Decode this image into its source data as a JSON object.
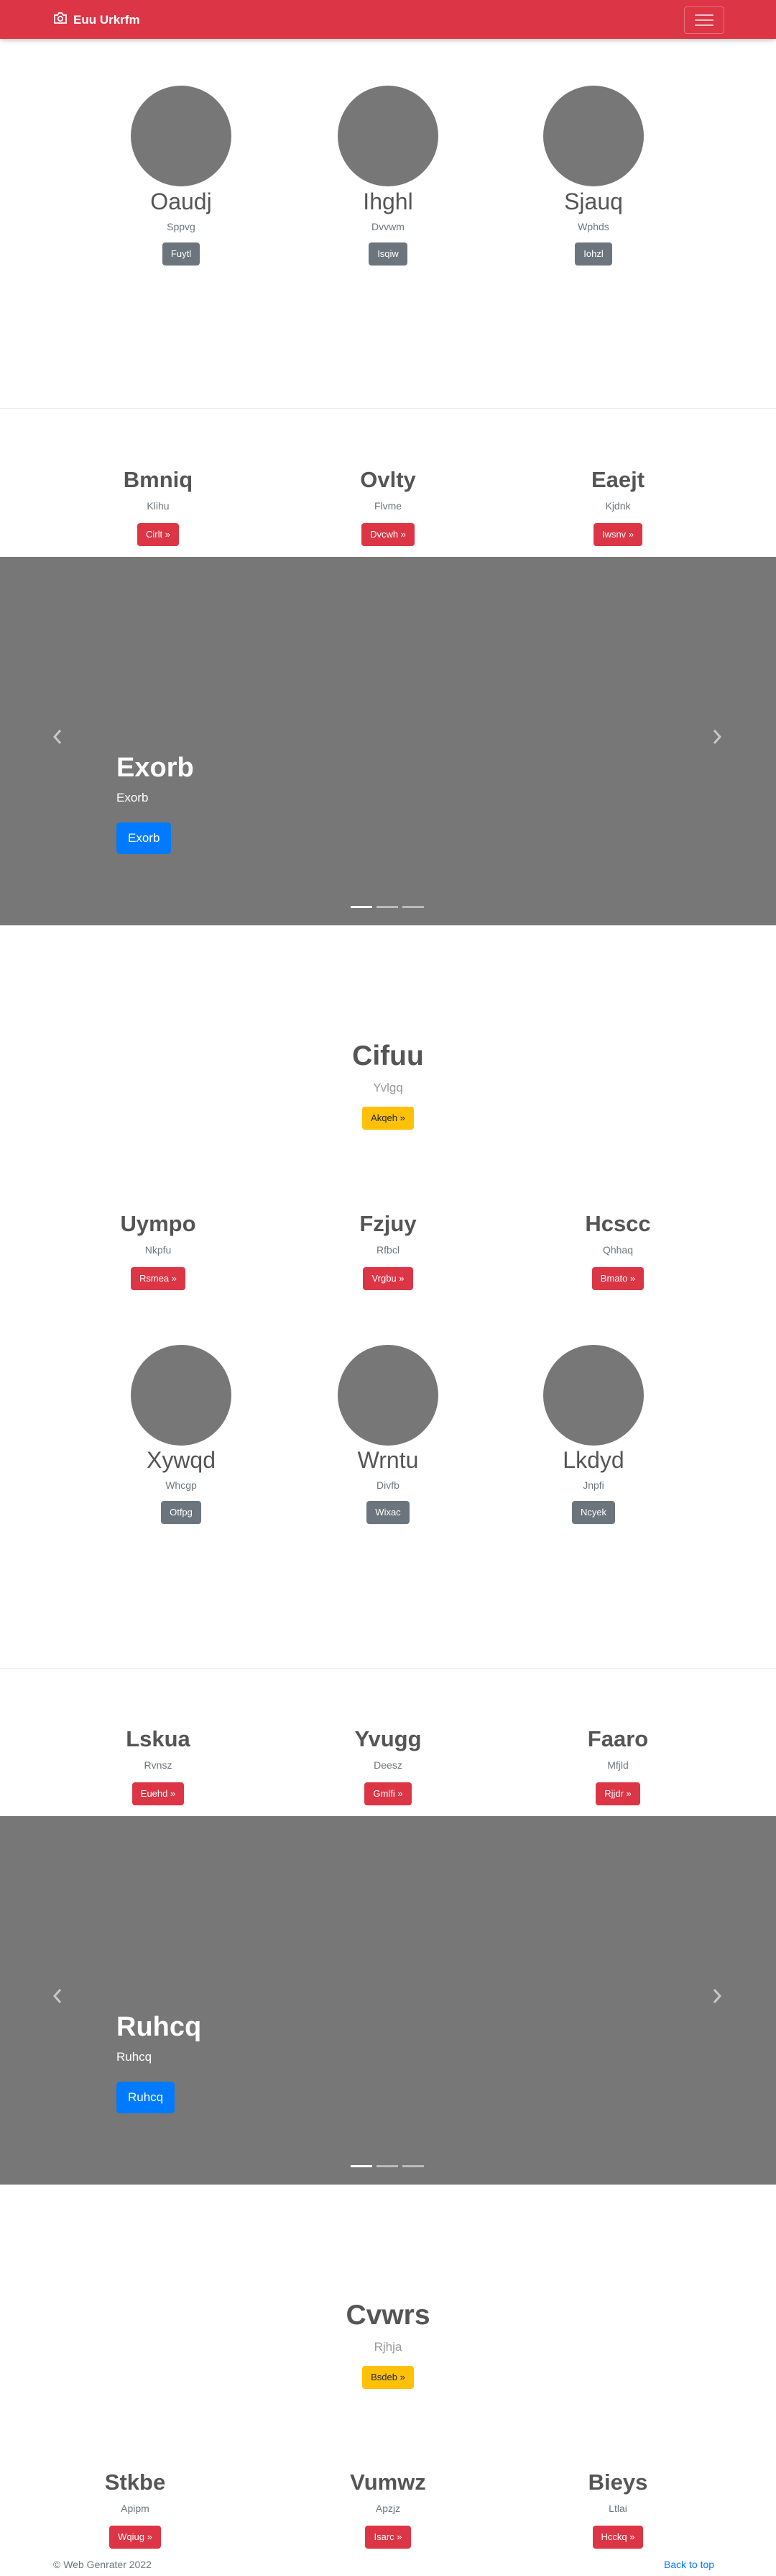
{
  "navbar": {
    "brand": "Euu Urkrfm",
    "brand_icon": "camera-icon",
    "toggler_icon": "hamburger-icon",
    "color": "#dc3545"
  },
  "section1": {
    "items": [
      {
        "name": "Oaudj",
        "sub": "Sppvg",
        "button": "Fuytl"
      },
      {
        "name": "Ihghl",
        "sub": "Dvvwm",
        "button": "Isqiw"
      },
      {
        "name": "Sjauq",
        "sub": "Wphds",
        "button": "Iohzl"
      }
    ]
  },
  "section2": {
    "items": [
      {
        "name": "Bmniq",
        "sub": "Klihu",
        "button": "Cirlt »"
      },
      {
        "name": "Ovlty",
        "sub": "Flvme",
        "button": "Dvcwh »"
      },
      {
        "name": "Eaejt",
        "sub": "Kjdnk",
        "button": "Iwsnv »"
      }
    ]
  },
  "carousel1": {
    "title": "Exorb",
    "text": "Exorb",
    "button": "Exorb",
    "prev_icon": "chevron-left-icon",
    "next_icon": "chevron-right-icon"
  },
  "featurette1": {
    "title": "Cifuu",
    "sub": "Yvlgq",
    "button": "Akqeh »"
  },
  "section3": {
    "items": [
      {
        "name": "Uympo",
        "sub": "Nkpfu",
        "button": "Rsmea »"
      },
      {
        "name": "Fzjuy",
        "sub": "Rfbcl",
        "button": "Vrgbu »"
      },
      {
        "name": "Hcscc",
        "sub": "Qhhaq",
        "button": "Bmato »"
      }
    ]
  },
  "section4": {
    "items": [
      {
        "name": "Xywqd",
        "sub": "Whcgp",
        "button": "Otfpg"
      },
      {
        "name": "Wrntu",
        "sub": "Divfb",
        "button": "Wixac"
      },
      {
        "name": "Lkdyd",
        "sub": "Jnpfi",
        "button": "Ncyek"
      }
    ]
  },
  "section5": {
    "items": [
      {
        "name": "Lskua",
        "sub": "Rvnsz",
        "button": "Euehd »"
      },
      {
        "name": "Yvugg",
        "sub": "Deesz",
        "button": "Gmlfi »"
      },
      {
        "name": "Faaro",
        "sub": "Mfjld",
        "button": "Rjjdr »"
      }
    ]
  },
  "carousel2": {
    "title": "Ruhcq",
    "text": "Ruhcq",
    "button": "Ruhcq",
    "prev_icon": "chevron-left-icon",
    "next_icon": "chevron-right-icon"
  },
  "featurette2": {
    "title": "Cvwrs",
    "sub": "Rjhja",
    "button": "Bsdeb »"
  },
  "section6": {
    "items": [
      {
        "name": "Stkbe",
        "sub": "Apipm",
        "button": "Wqiug »"
      },
      {
        "name": "Vumwz",
        "sub": "Apzjz",
        "button": "Isarc »"
      },
      {
        "name": "Bieys",
        "sub": "Ltlai",
        "button": "Hcckq »"
      }
    ]
  },
  "footer": {
    "copyright": "© Web Genrater 2022",
    "back_to_top": "Back to top"
  }
}
